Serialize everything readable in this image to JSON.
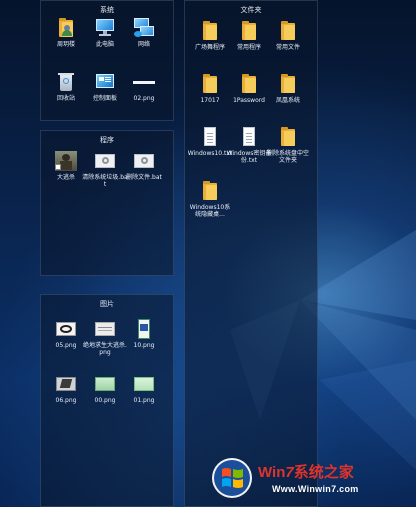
{
  "fences": {
    "system": {
      "title": "系统",
      "items": [
        {
          "label": "周玥楼"
        },
        {
          "label": "此电脑"
        },
        {
          "label": "网络"
        },
        {
          "label": "回收站"
        },
        {
          "label": "控制面板"
        },
        {
          "label": "02.png"
        }
      ]
    },
    "programs": {
      "title": "程序",
      "items": [
        {
          "label": "大逃杀"
        },
        {
          "label": "清除系统垃圾.bat"
        },
        {
          "label": "删除文件.bat"
        }
      ]
    },
    "pictures": {
      "title": "图片",
      "items": [
        {
          "label": "05.png"
        },
        {
          "label": "绝地求生大逃杀.png"
        },
        {
          "label": "10.png"
        },
        {
          "label": "06.png"
        },
        {
          "label": "00.png"
        },
        {
          "label": "01.png"
        }
      ]
    },
    "folders": {
      "title": "文件夹",
      "items": [
        {
          "label": "广场舞程序"
        },
        {
          "label": "常用程序"
        },
        {
          "label": "常用文件"
        },
        {
          "label": "17017"
        },
        {
          "label": "1Password"
        },
        {
          "label": "凤凰系统"
        },
        {
          "label": "Windows10.txt"
        },
        {
          "label": "Windows密钥备份.txt"
        },
        {
          "label": "删除系统盘中空文件夹"
        },
        {
          "label": "Windows10系统隐藏桌..."
        }
      ]
    }
  },
  "watermark": {
    "brand_prefix": "Win",
    "brand_digit": "7",
    "brand_suffix": "系统之家",
    "url": "Www.Winwin7.com"
  },
  "colors": {
    "folder": "#f6cd5b",
    "watermark_red": "#e0332b",
    "desktop_blue": "#0b2f66"
  }
}
